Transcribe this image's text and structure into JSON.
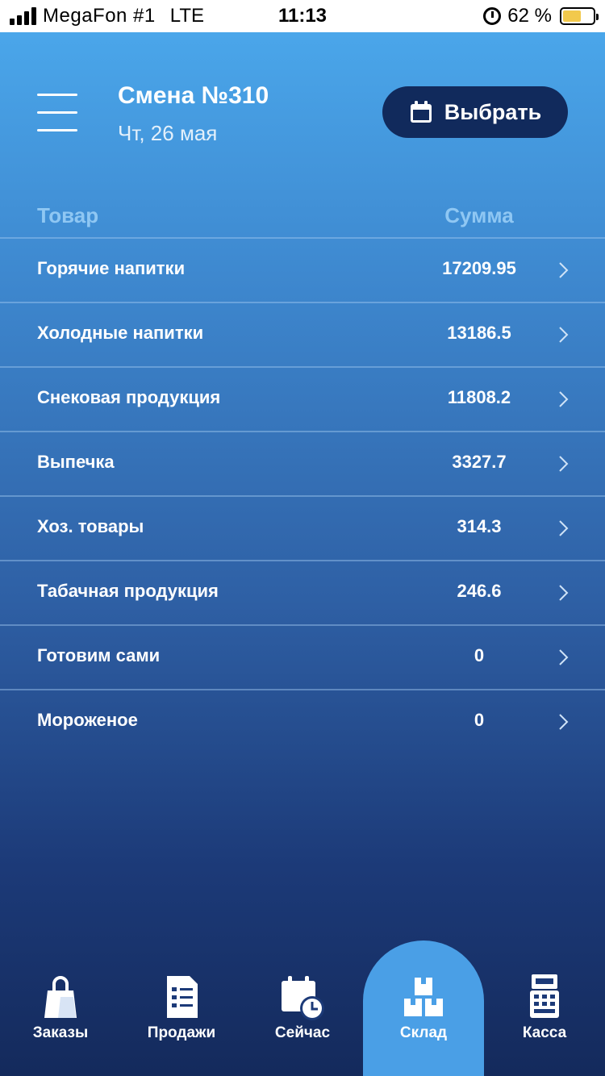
{
  "status_bar": {
    "carrier": "MegaFon #1",
    "network": "LTE",
    "time": "11:13",
    "battery": "62 %",
    "battery_level": 0.62
  },
  "header": {
    "shift_title": "Смена №310",
    "shift_date": "Чт, 26 мая",
    "pick_button_label": "Выбрать"
  },
  "table": {
    "col_product": "Товар",
    "col_sum": "Сумма",
    "rows": [
      {
        "name": "Горячие напитки",
        "sum": "17209.95"
      },
      {
        "name": "Холодные напитки",
        "sum": "13186.5"
      },
      {
        "name": "Снековая продукция",
        "sum": "11808.2"
      },
      {
        "name": "Выпечка",
        "sum": "3327.7"
      },
      {
        "name": "Хоз. товары",
        "sum": "314.3"
      },
      {
        "name": "Табачная продукция",
        "sum": "246.6"
      },
      {
        "name": "Готовим сами",
        "sum": "0"
      },
      {
        "name": "Мороженое",
        "sum": "0"
      }
    ]
  },
  "tabbar": {
    "active": "warehouse",
    "tabs": [
      {
        "key": "orders",
        "label": "Заказы",
        "icon": "shopping-bag-icon"
      },
      {
        "key": "sales",
        "label": "Продажи",
        "icon": "receipt-icon"
      },
      {
        "key": "now",
        "label": "Сейчас",
        "icon": "calendar-clock-icon"
      },
      {
        "key": "warehouse",
        "label": "Склад",
        "icon": "boxes-icon"
      },
      {
        "key": "cash",
        "label": "Касса",
        "icon": "cash-register-icon"
      }
    ]
  },
  "colors": {
    "accent_button": "#112a5c",
    "active_tab": "#4a9fe6",
    "header_text_muted": "#8fc7f3",
    "battery": "#f2c94c"
  }
}
